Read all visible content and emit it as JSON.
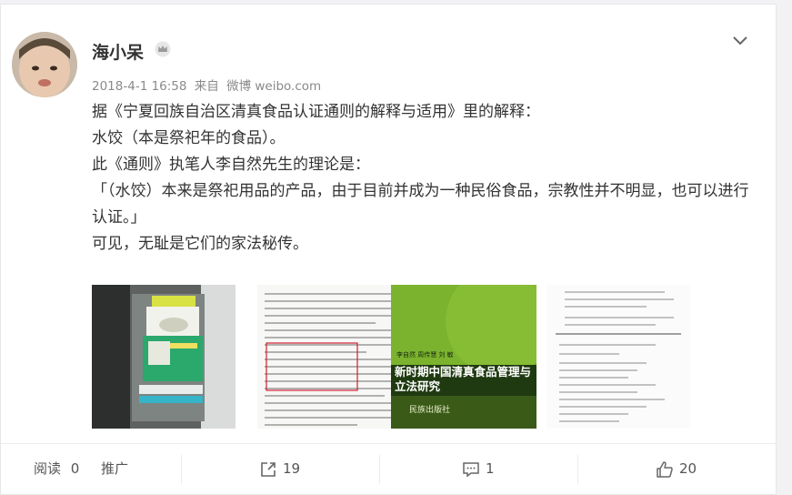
{
  "post": {
    "author": "海小呆",
    "timestamp": "2018-4-1 16:58",
    "via_prefix": "来自",
    "source": "微博 weibo.com",
    "lines": [
      "据《宁夏回族自治区清真食品认证通则的解释与适用》里的解释：",
      "水饺（本是祭祀年的食品）。",
      "此《通则》执笔人李自然先生的理论是：",
      "「（水饺）本来是祭祀用品的产品，由于目前并成为一种民俗食品，宗教性并不明显，也可以进行认证。」",
      "可见，无耻是它们的家法秘传。"
    ]
  },
  "images": [
    {
      "kind": "photo",
      "alt": "饺子包装照片"
    },
    {
      "kind": "scan",
      "alt": "书页扫描"
    },
    {
      "kind": "book-cover",
      "authors": "李自然 周传慧 刘 敏",
      "title": "新时期中国清真食品管理与立法研究",
      "publisher": "民族出版社"
    },
    {
      "kind": "scan",
      "alt": "版权页扫描"
    }
  ],
  "actions": {
    "read_label": "阅读",
    "read_count": "0",
    "promote_label": "推广",
    "repost_count": "19",
    "comment_count": "1",
    "like_count": "20"
  },
  "colors": {
    "text": "#333333",
    "meta": "#8a8a8a",
    "book_green": "#7bb32e"
  },
  "icons": [
    "crown-icon",
    "chevron-down-icon",
    "repost-icon",
    "comment-icon",
    "like-icon"
  ]
}
